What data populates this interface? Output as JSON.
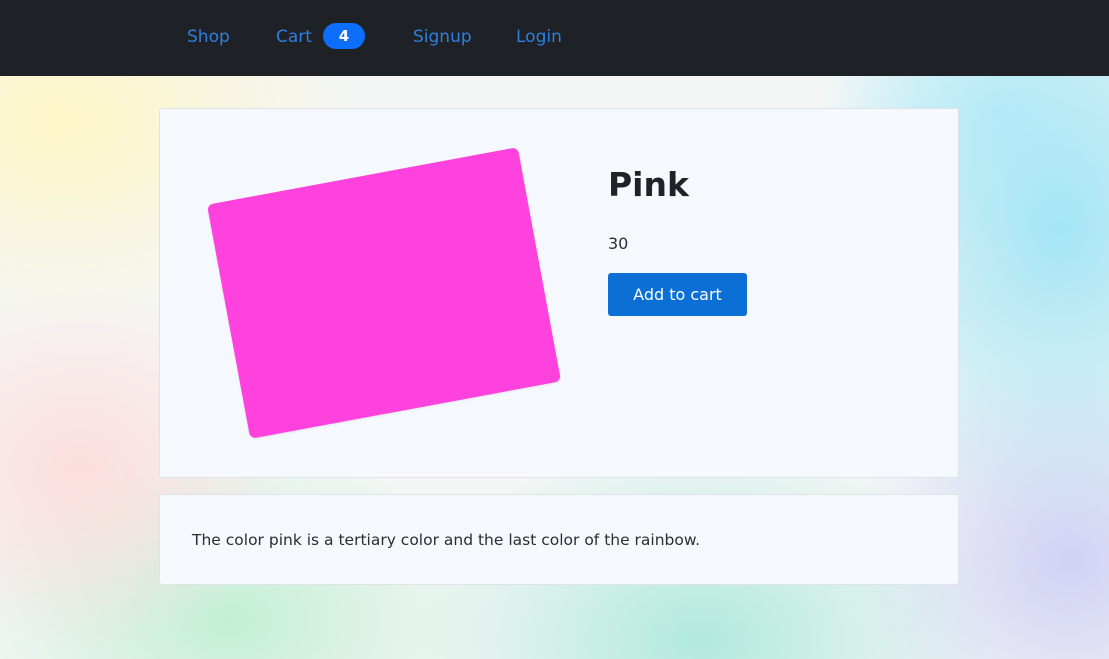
{
  "nav": {
    "links": [
      {
        "label": "Shop"
      },
      {
        "label": "Cart"
      },
      {
        "label": "Signup"
      },
      {
        "label": "Login"
      }
    ],
    "cart_count": "4"
  },
  "product": {
    "name": "Pink",
    "price": "30",
    "add_to_cart_label": "Add to cart",
    "swatch_color": "#ff42de"
  },
  "description": {
    "text": "The color pink is a tertiary color and the last color of the rainbow."
  },
  "colors": {
    "navbar_bg": "#1e2125",
    "link": "#2f7fe0",
    "primary_button": "#0b6fd6",
    "badge": "#0d6efd"
  }
}
